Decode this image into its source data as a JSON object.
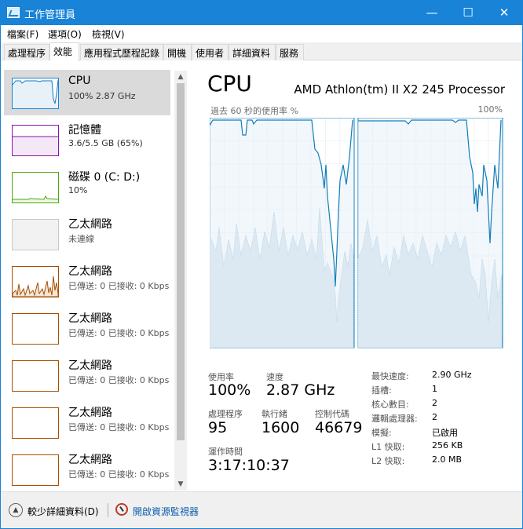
{
  "window": {
    "title": "工作管理員",
    "minimize": "—",
    "maximize": "☐",
    "close": "✕"
  },
  "menu": [
    "檔案(F)",
    "選項(O)",
    "檢視(V)"
  ],
  "tabs": [
    "處理程序",
    "效能",
    "應用程式歷程記錄",
    "開機",
    "使用者",
    "詳細資料",
    "服務"
  ],
  "active_tab": "效能",
  "sidebar": {
    "items": [
      {
        "name": "CPU",
        "sub": "100%  2.87 GHz",
        "color": "#1883d7",
        "kind": "cpu"
      },
      {
        "name": "記憶體",
        "sub": "3.6/5.5 GB (65%)",
        "color": "#8b12ae",
        "kind": "mem"
      },
      {
        "name": "磁碟 0 (C: D:)",
        "sub": "10%",
        "color": "#4da60c",
        "kind": "disk"
      },
      {
        "name": "乙太網路",
        "sub": "未連線",
        "color": "#b0b0b0",
        "kind": "eth-off"
      },
      {
        "name": "乙太網路",
        "sub": "已傳送: 0 已接收: 0 Kbps",
        "color": "#a74f01",
        "kind": "eth-active"
      },
      {
        "name": "乙太網路",
        "sub": "已傳送: 0 已接收: 0 Kbps",
        "color": "#a74f01",
        "kind": "eth"
      },
      {
        "name": "乙太網路",
        "sub": "已傳送: 0 已接收: 0 Kbps",
        "color": "#a74f01",
        "kind": "eth"
      },
      {
        "name": "乙太網路",
        "sub": "已傳送: 0 已接收: 0 Kbps",
        "color": "#a74f01",
        "kind": "eth"
      },
      {
        "name": "乙太網路",
        "sub": "已傳送: 0 已接收: 0 Kbps",
        "color": "#a74f01",
        "kind": "eth"
      }
    ]
  },
  "detail": {
    "title": "CPU",
    "model": "AMD Athlon(tm) II X2 245 Processor",
    "graph_label": "過去 60 秒的使用率 %",
    "graph_max": "100%",
    "stats": {
      "usage_label": "使用率",
      "usage_value": "100%",
      "speed_label": "速度",
      "speed_value": "2.87 GHz",
      "processes_label": "處理程序",
      "processes_value": "95",
      "threads_label": "執行緒",
      "threads_value": "1600",
      "handles_label": "控制代碼",
      "handles_value": "46679",
      "uptime_label": "運作時間",
      "uptime_value": "3:17:10:37"
    },
    "specs": [
      {
        "key": "最快速度:",
        "value": "2.90 GHz"
      },
      {
        "key": "插槽:",
        "value": "1"
      },
      {
        "key": "核心數目:",
        "value": "2"
      },
      {
        "key": "邏輯處理器:",
        "value": "2"
      },
      {
        "key": "模擬:",
        "value": "已啟用"
      },
      {
        "key": "L1 快取:",
        "value": "256 KB"
      },
      {
        "key": "L2 快取:",
        "value": "2.0 MB"
      }
    ]
  },
  "footer": {
    "fewer_details": "較少詳細資料(D)",
    "resource_monitor": "開啟資源監視器"
  },
  "colors": {
    "accent": "#1883d7",
    "graph_line": "#117dbb",
    "graph_fill": "#e8f1f8",
    "graph_grid": "#d9eaf4"
  }
}
